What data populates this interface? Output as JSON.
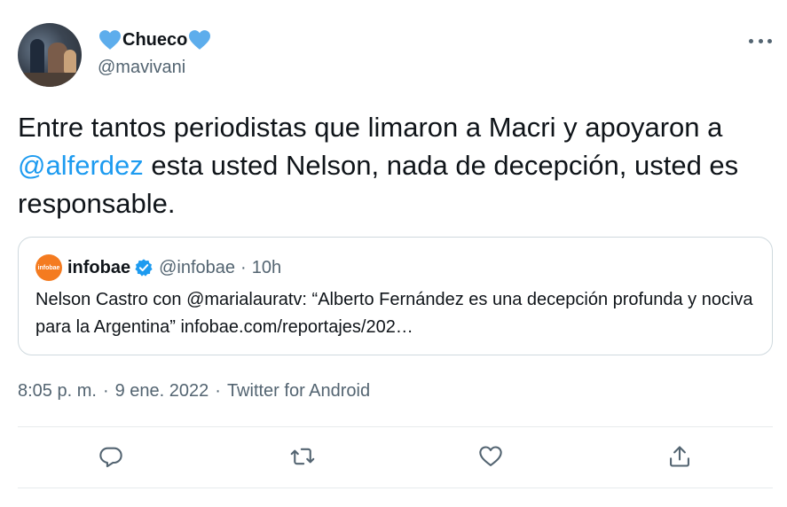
{
  "tweet": {
    "author": {
      "display_name": "Chueco",
      "name_emoji": "blue-heart",
      "handle": "@mavivani",
      "avatar": "profile-photo"
    },
    "text_parts": [
      "Entre tantos periodistas que limaron a Macri y apoyaron a ",
      "@alferdez",
      " esta usted Nelson, nada de decepción, usted es responsable."
    ],
    "quoted": {
      "logo_text": "infobae",
      "name": "infobae",
      "verified": true,
      "handle": "@infobae",
      "separator": "·",
      "time": "10h",
      "text": "Nelson Castro con @marialauratv: “Alberto Fernández es una decepción profunda y nociva para la Argentina” infobae.com/reportajes/202…"
    },
    "meta": {
      "time": "8:05 p. m.",
      "separator": "·",
      "date": "9 ene. 2022",
      "source": "Twitter for Android"
    }
  },
  "actions": {
    "reply_icon": "reply-icon",
    "retweet_icon": "retweet-icon",
    "like_icon": "heart-icon",
    "share_icon": "share-icon"
  },
  "colors": {
    "accent": "#1d9bf0",
    "secondary_text": "#536471",
    "heart": "#5dadec",
    "infobae_orange": "#f47b20"
  }
}
